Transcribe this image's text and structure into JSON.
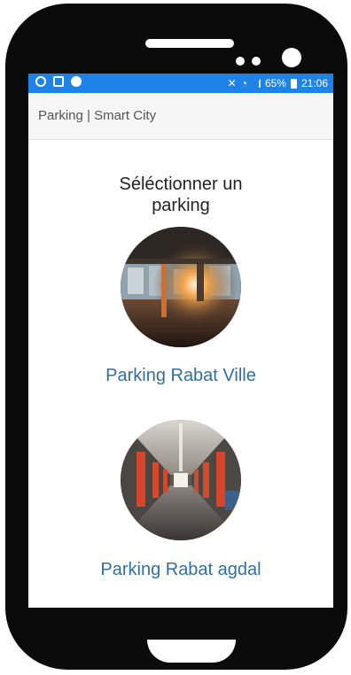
{
  "statusbar": {
    "battery": "65%",
    "time": "21:06",
    "icons_left": [
      "whatsapp-icon",
      "gallery-icon",
      "message-icon"
    ],
    "icons_right": [
      "mute-icon",
      "wifi-icon",
      "signal-icon",
      "battery-icon"
    ]
  },
  "app": {
    "title": "Parking | Smart City"
  },
  "main": {
    "heading": "Séléctionner un parking",
    "parkings": [
      {
        "name": "Parking Rabat Ville"
      },
      {
        "name": "Parking Rabat agdal"
      }
    ]
  },
  "colors": {
    "statusbar": "#1f82e6",
    "link": "#2f6fa5",
    "frame": "#0b0b0b"
  }
}
